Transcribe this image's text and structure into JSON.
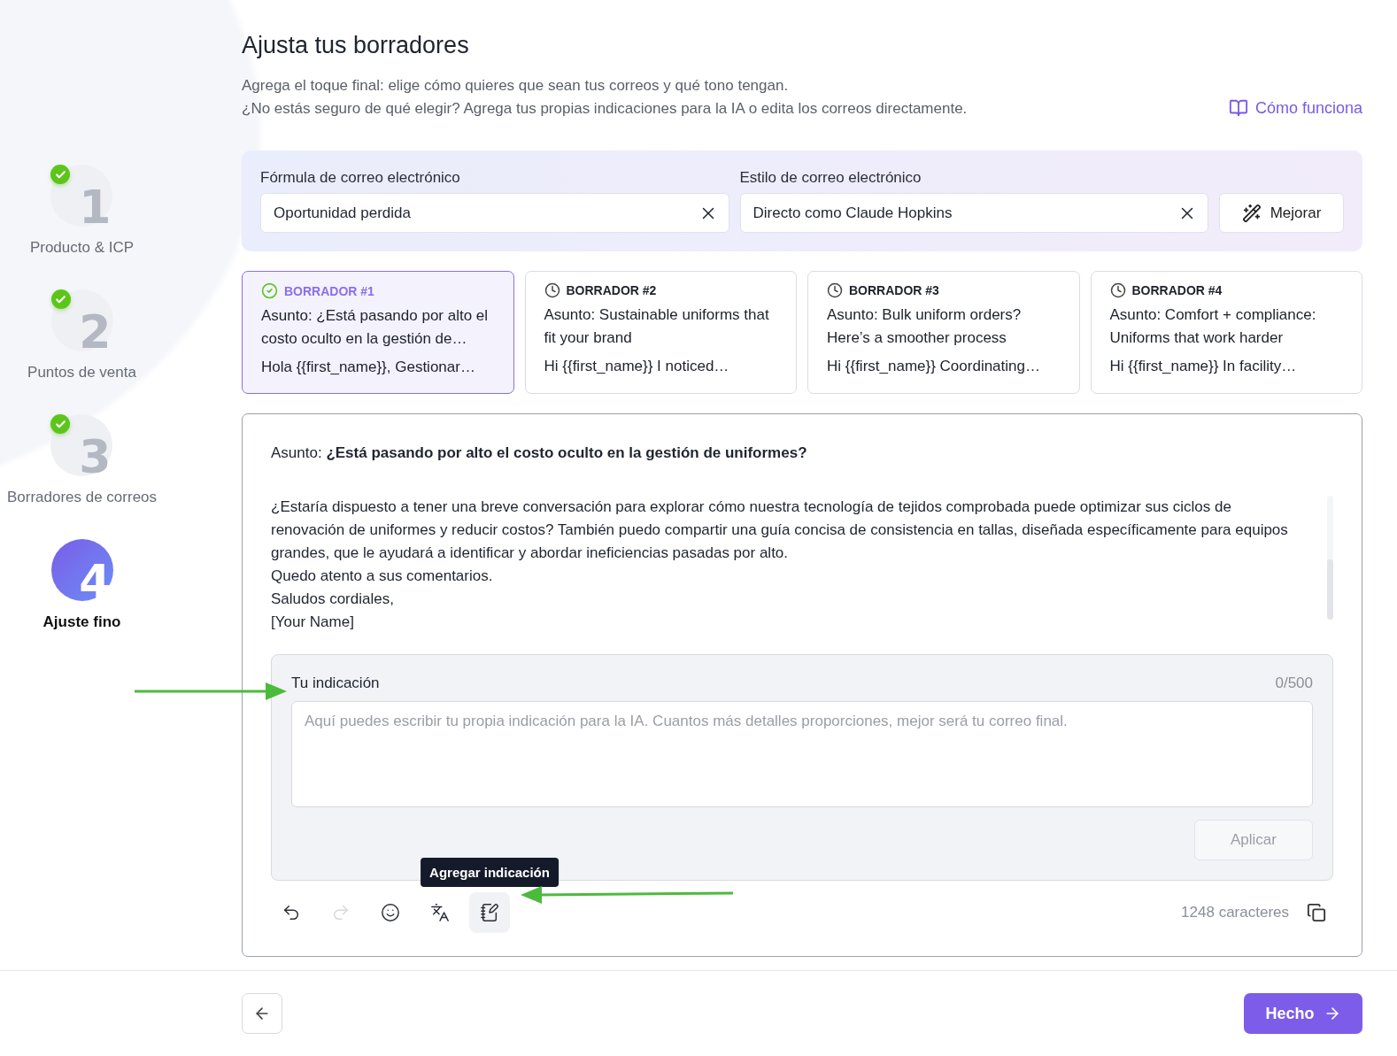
{
  "steps": [
    {
      "number": "1",
      "label": "Producto & ICP",
      "completed": true,
      "selected": false
    },
    {
      "number": "2",
      "label": "Puntos de venta",
      "completed": true,
      "selected": false
    },
    {
      "number": "3",
      "label": "Borradores de correos",
      "completed": true,
      "selected": false
    },
    {
      "number": "4",
      "label": "Ajuste fino",
      "completed": false,
      "selected": true
    }
  ],
  "header": {
    "title": "Ajusta tus borradores",
    "subtitle_lines": [
      "Agrega el toque final: elige cómo quieres que sean tus correos y qué tono tengan.",
      "¿No estás seguro de qué elegir? Agrega tus propias indicaciones para la IA o edita los correos directamente."
    ],
    "help_link": "Cómo funciona"
  },
  "settings": {
    "fields": [
      {
        "label": "Fórmula de correo electrónico",
        "value": "Oportunidad perdida"
      },
      {
        "label": "Estilo de correo electrónico",
        "value": "Directo como Claude Hopkins"
      }
    ],
    "improve_button": "Mejorar"
  },
  "drafts": [
    {
      "title": "BORRADOR #1",
      "selected": true,
      "lines": [
        "Asunto: ¿Está pasando por alto el costo oculto en la gestión de…",
        "Hola {{first_name}}, Gestionar…"
      ]
    },
    {
      "title": "BORRADOR #2",
      "selected": false,
      "lines": [
        "Asunto: Sustainable uniforms that fit your brand",
        "Hi {{first_name}} I noticed…"
      ]
    },
    {
      "title": "BORRADOR #3",
      "selected": false,
      "lines": [
        "Asunto: Bulk uniform orders? Here’s a smoother process",
        "Hi {{first_name}} Coordinating…"
      ]
    },
    {
      "title": "BORRADOR #4",
      "selected": false,
      "lines": [
        "Asunto: Comfort + compliance: Uniforms that work harder",
        "Hi {{first_name}} In facility…"
      ]
    }
  ],
  "editor": {
    "subject_label": "Asunto:",
    "subject": "¿Está pasando por alto el costo oculto en la gestión de uniformes?",
    "body": [
      "¿Estaría dispuesto a tener una breve conversación para explorar cómo nuestra tecnología de tejidos comprobada puede optimizar sus ciclos de renovación de uniformes y reducir costos? También puedo compartir una guía concisa de consistencia en tallas, diseñada específicamente para equipos grandes, que le ayudará a identificar y abordar ineficiencias pasadas por alto.",
      "Quedo atento a sus comentarios.",
      "Saludos cordiales,",
      "[Your Name]"
    ],
    "prompt": {
      "label": "Tu indicación",
      "counter": "0/500",
      "placeholder": "Aquí puedes escribir tu propia indicación para la IA. Cuantos más detalles proporciones, mejor será tu correo final.",
      "apply_button": "Aplicar",
      "apply_disabled": true
    },
    "toolbar": [
      {
        "kind": "undo",
        "disabled": false,
        "active": false
      },
      {
        "kind": "redo",
        "disabled": true,
        "active": false
      },
      {
        "kind": "emoji",
        "disabled": false,
        "active": false
      },
      {
        "kind": "translate",
        "disabled": false,
        "active": false
      },
      {
        "kind": "note",
        "disabled": false,
        "active": true
      }
    ],
    "tooltip": "Agregar indicación",
    "char_count": "1248 caracteres"
  },
  "footer": {
    "done_button": "Hecho"
  }
}
